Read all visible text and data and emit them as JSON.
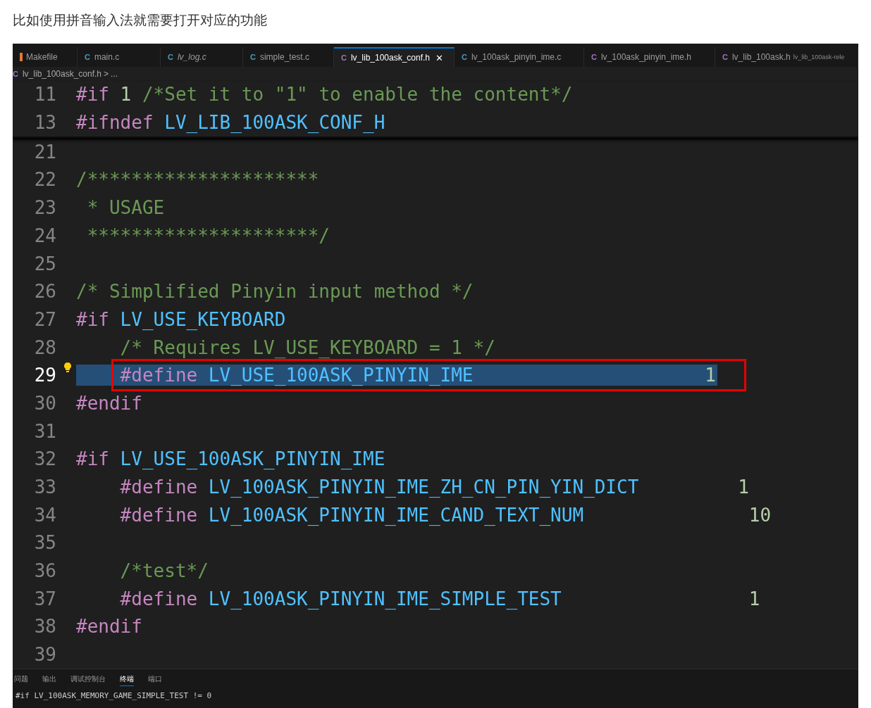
{
  "caption": "比如使用拼音输入法就需要打开对应的功能",
  "tabs": [
    {
      "kind": "makefile",
      "label": "Makefile",
      "italic": false,
      "selected": false
    },
    {
      "kind": "c",
      "icon": "C",
      "label": "main.c",
      "italic": false,
      "selected": false
    },
    {
      "kind": "c",
      "icon": "C",
      "label": "lv_log.c",
      "italic": true,
      "selected": false
    },
    {
      "kind": "c",
      "icon": "C",
      "label": "simple_test.c",
      "italic": false,
      "selected": false
    },
    {
      "kind": "h",
      "icon": "C",
      "label": "lv_lib_100ask_conf.h",
      "italic": false,
      "selected": true,
      "close": "✕"
    },
    {
      "kind": "c",
      "icon": "C",
      "label": "lv_100ask_pinyin_ime.c",
      "italic": false,
      "selected": false
    },
    {
      "kind": "h",
      "icon": "C",
      "label": "lv_100ask_pinyin_ime.h",
      "italic": false,
      "selected": false
    },
    {
      "kind": "h",
      "icon": "C",
      "label": "lv_lib_100ask.h",
      "italic": false,
      "selected": false,
      "description": "lv_lib_100ask-rele"
    }
  ],
  "breadcrumb": {
    "icon": "C",
    "file": "lv_lib_100ask_conf.h",
    "separator": ">",
    "more": "..."
  },
  "sticky_lines": [
    {
      "number": "11",
      "tokens": [
        {
          "kind": "keyword",
          "text": "#if"
        },
        {
          "kind": "number",
          "text": " 1"
        },
        {
          "kind": "comment",
          "text": " /*Set it to \"1\" to enable the content*/"
        }
      ]
    },
    {
      "number": "13",
      "tokens": [
        {
          "kind": "keyword",
          "text": "#ifndef"
        },
        {
          "kind": "macro",
          "text": " LV_LIB_100ASK_CONF_H"
        }
      ]
    }
  ],
  "highlight_frame": true,
  "lines": [
    {
      "number": "21",
      "selected": false
    },
    {
      "number": "22",
      "selected": false,
      "tokens": [
        {
          "kind": "comment",
          "text": "/*********************"
        }
      ]
    },
    {
      "number": "23",
      "selected": false,
      "tokens": [
        {
          "kind": "comment",
          "text": " * USAGE"
        }
      ]
    },
    {
      "number": "24",
      "selected": false,
      "tokens": [
        {
          "kind": "comment",
          "text": " *********************/"
        }
      ]
    },
    {
      "number": "25",
      "selected": false
    },
    {
      "number": "26",
      "selected": false,
      "tokens": [
        {
          "kind": "comment",
          "text": "/* Simplified Pinyin input method */"
        }
      ]
    },
    {
      "number": "27",
      "selected": false,
      "tokens": [
        {
          "kind": "keyword",
          "text": "#if"
        },
        {
          "kind": "macro",
          "text": " LV_USE_KEYBOARD"
        }
      ]
    },
    {
      "number": "28",
      "selected": false,
      "tokens": [
        {
          "kind": "comment",
          "text": "    /* Requires LV_USE_KEYBOARD = 1 */"
        }
      ]
    },
    {
      "number": "29",
      "selected": true,
      "tokens": [
        {
          "kind": "keyword",
          "text": "    #define"
        },
        {
          "kind": "macro",
          "text": " LV_USE_100ASK_PINYIN_IME"
        },
        {
          "kind": "number",
          "text": "                     1"
        }
      ]
    },
    {
      "number": "30",
      "selected": false,
      "tokens": [
        {
          "kind": "keyword",
          "text": "#endif"
        }
      ]
    },
    {
      "number": "31",
      "selected": false
    },
    {
      "number": "32",
      "selected": false,
      "tokens": [
        {
          "kind": "keyword",
          "text": "#if"
        },
        {
          "kind": "macro",
          "text": " LV_USE_100ASK_PINYIN_IME"
        }
      ]
    },
    {
      "number": "33",
      "selected": false,
      "tokens": [
        {
          "kind": "keyword",
          "text": "    #define"
        },
        {
          "kind": "macro",
          "text": " LV_100ASK_PINYIN_IME_ZH_CN_PIN_YIN_DICT"
        },
        {
          "kind": "number",
          "text": "         1"
        }
      ]
    },
    {
      "number": "34",
      "selected": false,
      "tokens": [
        {
          "kind": "keyword",
          "text": "    #define"
        },
        {
          "kind": "macro",
          "text": " LV_100ASK_PINYIN_IME_CAND_TEXT_NUM"
        },
        {
          "kind": "number",
          "text": "               10"
        }
      ]
    },
    {
      "number": "35",
      "selected": false
    },
    {
      "number": "36",
      "selected": false,
      "tokens": [
        {
          "kind": "comment",
          "text": "    /*test*/"
        }
      ]
    },
    {
      "number": "37",
      "selected": false,
      "tokens": [
        {
          "kind": "keyword",
          "text": "    #define"
        },
        {
          "kind": "macro",
          "text": " LV_100ASK_PINYIN_IME_SIMPLE_TEST"
        },
        {
          "kind": "number",
          "text": "                 1"
        }
      ]
    },
    {
      "number": "38",
      "selected": false,
      "tokens": [
        {
          "kind": "keyword",
          "text": "#endif"
        }
      ]
    },
    {
      "number": "39",
      "selected": false
    }
  ],
  "panel": {
    "tabs": [
      {
        "label": "问题",
        "selected": false
      },
      {
        "label": "输出",
        "selected": false
      },
      {
        "label": "调试控制台",
        "selected": false
      },
      {
        "label": "终端",
        "selected": true
      },
      {
        "label": "端口",
        "selected": false
      }
    ],
    "terminal_line": "#if LV_100ASK_MEMORY_GAME_SIMPLE_TEST != 0"
  }
}
